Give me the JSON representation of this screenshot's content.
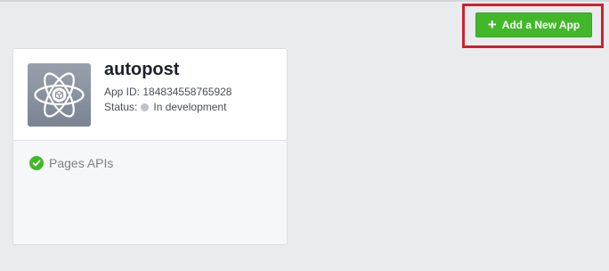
{
  "header": {
    "add_app_label": "Add a New App",
    "add_app_icon": "plus-icon"
  },
  "app": {
    "name": "autopost",
    "id_label": "App ID:",
    "id_value": "184834558765928",
    "status_label": "Status:",
    "status_value": "In development",
    "status_color": "#bec3c9",
    "icon": "atom-cube-icon"
  },
  "products": [
    {
      "label": "Pages APIs",
      "status_icon": "check-circle-icon",
      "status_color": "#42b72a"
    }
  ],
  "colors": {
    "accent": "#42b72a",
    "highlight": "#d0202b",
    "background": "#e9ebee"
  }
}
